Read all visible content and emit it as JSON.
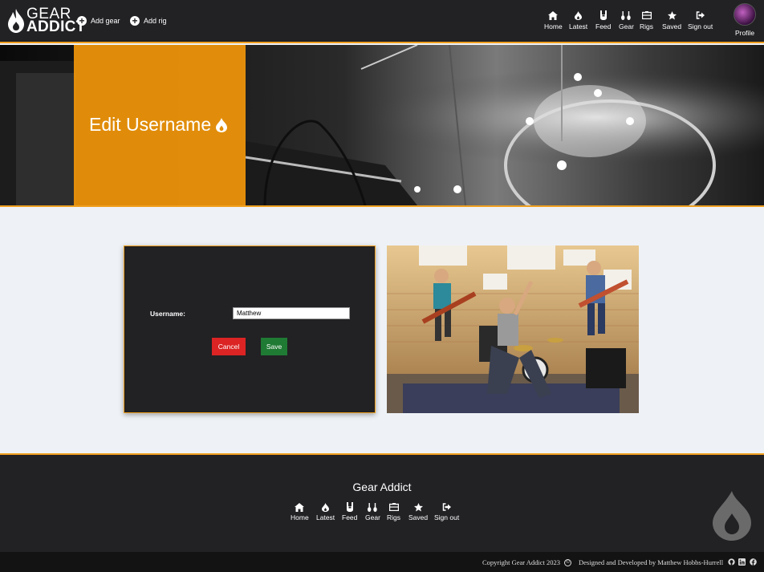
{
  "app": {
    "logo_top": "GEAR",
    "logo_bottom": "ADDICT"
  },
  "header": {
    "add_gear": "Add gear",
    "add_rig": "Add rig",
    "nav": [
      {
        "label": "Home",
        "icon": "home-icon"
      },
      {
        "label": "Latest",
        "icon": "flame-icon"
      },
      {
        "label": "Feed",
        "icon": "rock-hand-icon"
      },
      {
        "label": "Gear",
        "icon": "guitars-icon"
      },
      {
        "label": "Rigs",
        "icon": "amp-icon"
      },
      {
        "label": "Saved",
        "icon": "star-icon"
      },
      {
        "label": "Sign out",
        "icon": "sign-out-icon"
      }
    ],
    "profile": "Profile"
  },
  "hero": {
    "title": "Edit Username"
  },
  "form": {
    "username_label": "Username:",
    "username_value": "Matthew",
    "cancel": "Cancel",
    "save": "Save"
  },
  "footer": {
    "title": "Gear Addict",
    "nav": [
      {
        "label": "Home",
        "icon": "home-icon"
      },
      {
        "label": "Latest",
        "icon": "flame-icon"
      },
      {
        "label": "Feed",
        "icon": "rock-hand-icon"
      },
      {
        "label": "Gear",
        "icon": "guitars-icon"
      },
      {
        "label": "Rigs",
        "icon": "amp-icon"
      },
      {
        "label": "Saved",
        "icon": "star-icon"
      },
      {
        "label": "Sign out",
        "icon": "sign-out-icon"
      }
    ],
    "copyright": "Copyright Gear Addict 2023",
    "designer": "Designed and Developed by Matthew Hobbs-Hurrell",
    "social": [
      "github-icon",
      "linkedin-icon",
      "facebook-icon"
    ]
  },
  "colors": {
    "accent": "#f0a020",
    "dark": "#222124",
    "cancel": "#dc2424",
    "save": "#1f7a33",
    "page_bg": "#eef2f7"
  }
}
